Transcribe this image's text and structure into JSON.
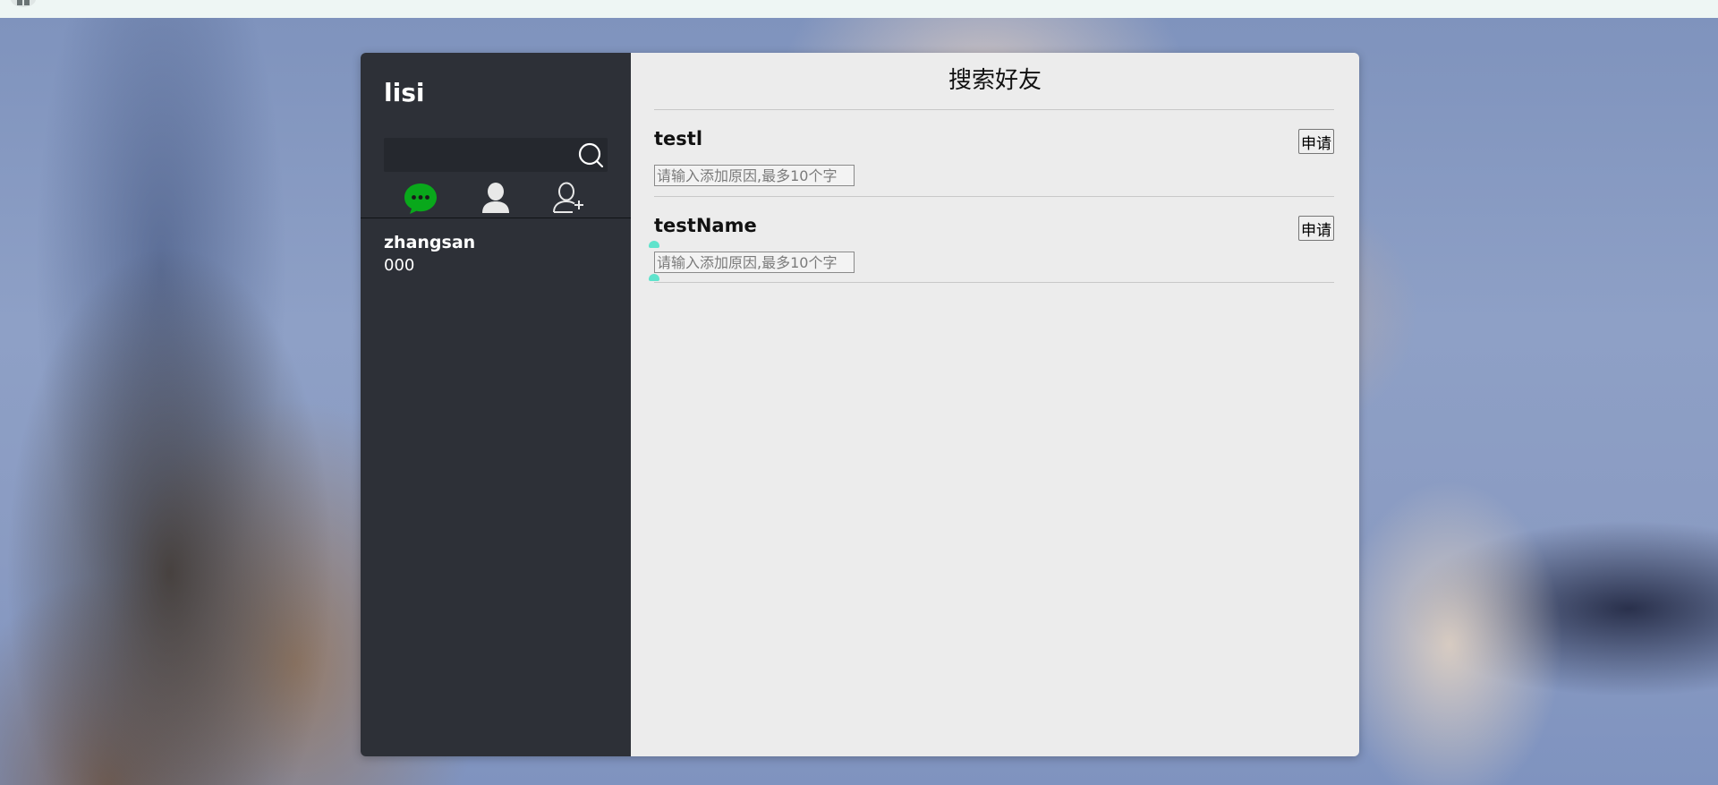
{
  "sidebar": {
    "username": "lisi",
    "search": {
      "value": "",
      "placeholder": ""
    },
    "tabs": [
      {
        "icon": "chat-icon",
        "active": true
      },
      {
        "icon": "user-icon",
        "active": false
      },
      {
        "icon": "add-user-icon",
        "active": false
      }
    ],
    "contacts": [
      {
        "name": "zhangsan",
        "last_message": "000"
      }
    ]
  },
  "main": {
    "title": "搜索好友",
    "results": [
      {
        "name": "testl",
        "apply_label": "申请",
        "reason_placeholder": "请输入添加原因,最多10个字"
      },
      {
        "name": "testName",
        "apply_label": "申请",
        "reason_placeholder": "请输入添加原因,最多10个字"
      }
    ]
  },
  "colors": {
    "accent_green": "#09a81b",
    "sidebar_bg": "#2d3037",
    "main_bg": "#ececec"
  }
}
